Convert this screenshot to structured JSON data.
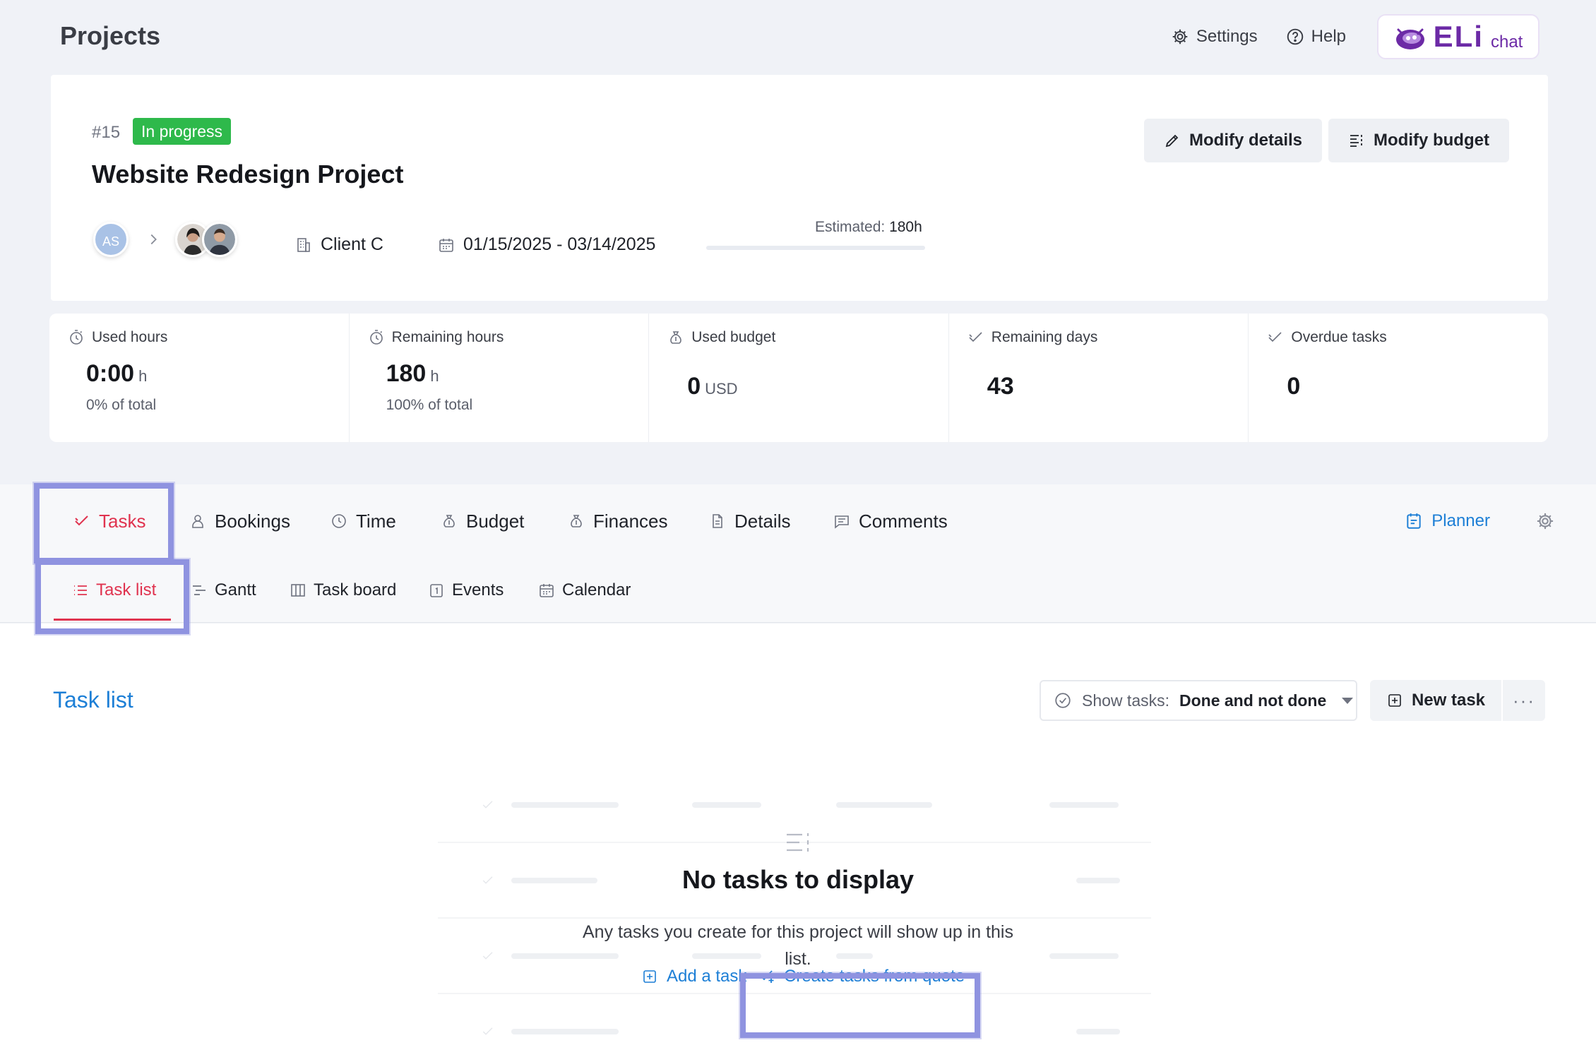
{
  "header": {
    "title": "Projects",
    "settings_label": "Settings",
    "help_label": "Help",
    "eli_logo_text": "ELi",
    "eli_chat_text": "chat"
  },
  "project": {
    "id": "#15",
    "status": "In progress",
    "name": "Website Redesign Project",
    "modify_details_label": "Modify details",
    "modify_budget_label": "Modify budget",
    "owner_initials": "AS",
    "client": "Client C",
    "date_range": "01/15/2025 - 03/14/2025",
    "estimated_label": "Estimated:",
    "estimated_value": "180h",
    "estimated_progress": 0
  },
  "stats": [
    {
      "label": "Used hours",
      "value": "0:00",
      "unit": "h",
      "sub": "0% of total",
      "icon": "stopwatch-icon"
    },
    {
      "label": "Remaining hours",
      "value": "180",
      "unit": "h",
      "sub": "100% of total",
      "icon": "stopwatch-icon"
    },
    {
      "label": "Used budget",
      "value": "0",
      "unit": "USD",
      "sub": "",
      "icon": "money-bag-icon"
    },
    {
      "label": "Remaining days",
      "value": "43",
      "unit": "",
      "sub": "",
      "icon": "double-check-icon"
    },
    {
      "label": "Overdue tasks",
      "value": "0",
      "unit": "",
      "sub": "",
      "icon": "double-check-icon"
    }
  ],
  "tabs": [
    {
      "label": "Tasks",
      "active": true
    },
    {
      "label": "Bookings"
    },
    {
      "label": "Time"
    },
    {
      "label": "Budget"
    },
    {
      "label": "Finances"
    },
    {
      "label": "Details"
    },
    {
      "label": "Comments"
    }
  ],
  "planner_label": "Planner",
  "subtabs": [
    {
      "label": "Task list",
      "active": true
    },
    {
      "label": "Gantt"
    },
    {
      "label": "Task board"
    },
    {
      "label": "Events"
    },
    {
      "label": "Calendar"
    }
  ],
  "task_list": {
    "title": "Task list",
    "filter_prefix": "Show tasks:",
    "filter_value": "Done and not done",
    "new_task_label": "New task",
    "more_label": "···",
    "empty_title": "No tasks to display",
    "empty_desc": "Any tasks you create for this project will show up in this list.",
    "add_task_label": "Add a task",
    "create_from_quote_label": "Create tasks from quote"
  },
  "colors": {
    "accent_red": "#e0334f",
    "link_blue": "#1d7fd6",
    "status_green": "#2eb94b",
    "highlight": "#8f93e0",
    "eli_purple": "#6c2aa6"
  }
}
